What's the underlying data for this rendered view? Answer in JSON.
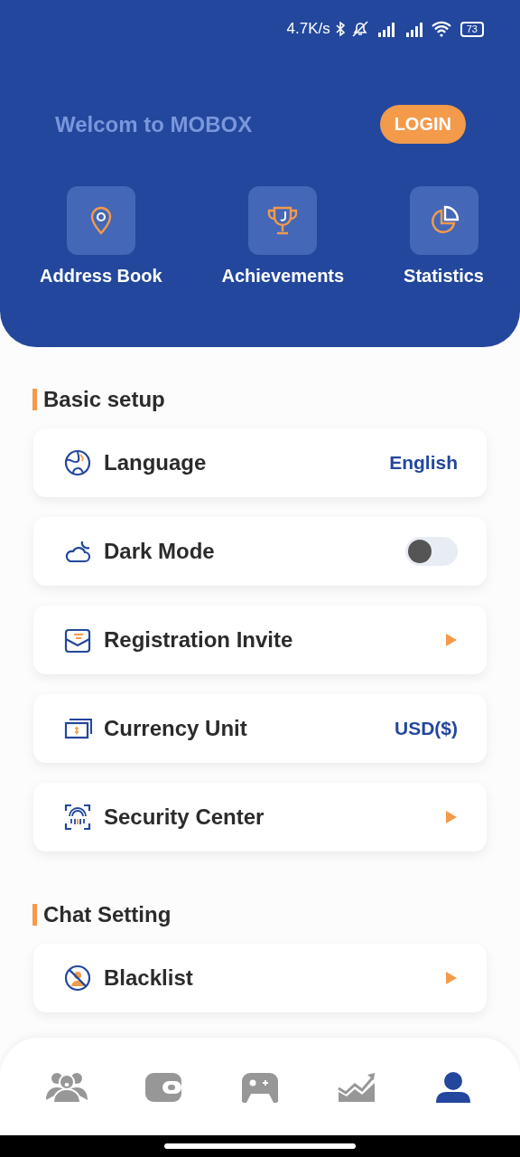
{
  "status_bar": {
    "speed": "4.7K/s",
    "battery": "73"
  },
  "header": {
    "welcome": "Welcom to MOBOX",
    "login": "LOGIN"
  },
  "quick_links": [
    {
      "label": "Address Book"
    },
    {
      "label": "Achievements"
    },
    {
      "label": "Statistics"
    }
  ],
  "sections": [
    {
      "title": "Basic setup",
      "items": [
        {
          "kind": "value",
          "label": "Language",
          "value": "English"
        },
        {
          "kind": "toggle",
          "label": "Dark Mode",
          "on": false
        },
        {
          "kind": "arrow",
          "label": "Registration Invite"
        },
        {
          "kind": "value",
          "label": "Currency Unit",
          "value": "USD($)"
        },
        {
          "kind": "arrow",
          "label": "Security Center"
        }
      ]
    },
    {
      "title": "Chat Setting",
      "items": [
        {
          "kind": "arrow",
          "label": "Blacklist"
        }
      ]
    }
  ],
  "bottom_nav": [
    {
      "selected": false
    },
    {
      "selected": false
    },
    {
      "selected": false
    },
    {
      "selected": false
    },
    {
      "selected": true
    }
  ]
}
